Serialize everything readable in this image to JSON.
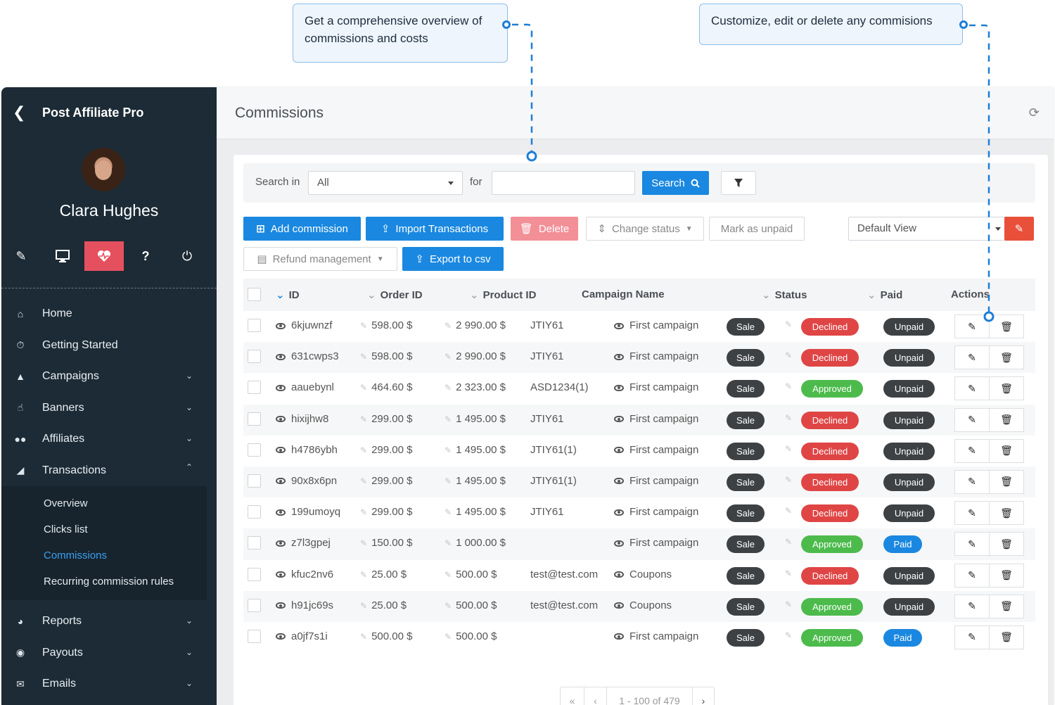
{
  "callouts": {
    "overview": "Get a comprehensive overview of commissions and costs",
    "actions": "Customize, edit or delete any commisions"
  },
  "app": {
    "title": "Post Affiliate Pro",
    "user_name": "Clara Hughes"
  },
  "sidebar": {
    "tools": [
      "pencil-icon",
      "monitor-icon",
      "heartbeat-icon",
      "question-icon",
      "power-icon"
    ],
    "menu": [
      {
        "label": "Home",
        "icon": "home-icon",
        "chevron": false
      },
      {
        "label": "Getting Started",
        "icon": "stopwatch-icon",
        "chevron": false
      },
      {
        "label": "Campaigns",
        "icon": "megaphone-icon",
        "chevron": true
      },
      {
        "label": "Banners",
        "icon": "hand-icon",
        "chevron": true
      },
      {
        "label": "Affiliates",
        "icon": "users-icon",
        "chevron": true
      },
      {
        "label": "Transactions",
        "icon": "basket-icon",
        "chevron": true,
        "expanded": true
      }
    ],
    "submenu": [
      "Overview",
      "Clicks list",
      "Commissions",
      "Recurring commission rules"
    ],
    "submenu_active": "Commissions",
    "menu_after": [
      {
        "label": "Reports",
        "icon": "pie-chart-icon"
      },
      {
        "label": "Payouts",
        "icon": "money-bag-icon"
      },
      {
        "label": "Emails",
        "icon": "envelope-icon"
      }
    ]
  },
  "header": {
    "title": "Commissions"
  },
  "search": {
    "search_in_label": "Search in",
    "search_in_value": "All",
    "for_label": "for",
    "search_button": "Search"
  },
  "toolbar": {
    "add_commission": "Add commission",
    "import_transactions": "Import Transactions",
    "delete": "Delete",
    "change_status": "Change status",
    "mark_as_unpaid": "Mark as unpaid",
    "view_select": "Default View",
    "refund_management": "Refund management",
    "export_csv": "Export to csv"
  },
  "table": {
    "columns": [
      "ID",
      "Order ID",
      "Product ID",
      "Campaign Name",
      "Status",
      "Paid",
      "Actions"
    ],
    "rows": [
      {
        "id": "6kjuwnzf",
        "order": "598.00 $",
        "product": "2 990.00 $",
        "product_id": "JTIY61",
        "campaign": "First campaign",
        "type": "Sale",
        "status": "Declined",
        "paid": "Unpaid"
      },
      {
        "id": "631cwps3",
        "order": "598.00 $",
        "product": "2 990.00 $",
        "product_id": "JTIY61",
        "campaign": "First campaign",
        "type": "Sale",
        "status": "Declined",
        "paid": "Unpaid"
      },
      {
        "id": "aauebynl",
        "order": "464.60 $",
        "product": "2 323.00 $",
        "product_id": "ASD1234(1)",
        "campaign": "First campaign",
        "type": "Sale",
        "status": "Approved",
        "paid": "Unpaid"
      },
      {
        "id": "hixijhw8",
        "order": "299.00 $",
        "product": "1 495.00 $",
        "product_id": "JTIY61",
        "campaign": "First campaign",
        "type": "Sale",
        "status": "Declined",
        "paid": "Unpaid"
      },
      {
        "id": "h4786ybh",
        "order": "299.00 $",
        "product": "1 495.00 $",
        "product_id": "JTIY61(1)",
        "campaign": "First campaign",
        "type": "Sale",
        "status": "Declined",
        "paid": "Unpaid"
      },
      {
        "id": "90x8x6pn",
        "order": "299.00 $",
        "product": "1 495.00 $",
        "product_id": "JTIY61(1)",
        "campaign": "First campaign",
        "type": "Sale",
        "status": "Declined",
        "paid": "Unpaid"
      },
      {
        "id": "199umoyq",
        "order": "299.00 $",
        "product": "1 495.00 $",
        "product_id": "JTIY61",
        "campaign": "First campaign",
        "type": "Sale",
        "status": "Declined",
        "paid": "Unpaid"
      },
      {
        "id": "z7l3gpej",
        "order": "150.00 $",
        "product": "1 000.00 $",
        "product_id": "",
        "campaign": "First campaign",
        "type": "Sale",
        "status": "Approved",
        "paid": "Paid"
      },
      {
        "id": "kfuc2nv6",
        "order": "25.00 $",
        "product": "500.00 $",
        "product_id": "test@test.com",
        "campaign": "Coupons",
        "type": "Sale",
        "status": "Declined",
        "paid": "Unpaid"
      },
      {
        "id": "h91jc69s",
        "order": "25.00 $",
        "product": "500.00 $",
        "product_id": "test@test.com",
        "campaign": "Coupons",
        "type": "Sale",
        "status": "Approved",
        "paid": "Unpaid"
      },
      {
        "id": "a0jf7s1i",
        "order": "500.00 $",
        "product": "500.00 $",
        "product_id": "",
        "campaign": "First campaign",
        "type": "Sale",
        "status": "Approved",
        "paid": "Paid"
      }
    ]
  },
  "pager": {
    "first": "«",
    "prev": "‹",
    "range": "1 - 100 of 479",
    "next": "›"
  },
  "colors": {
    "sidebar": "#1c2b36",
    "accent": "#1a88e0",
    "danger": "#e04545",
    "success": "#4cbb4c",
    "active_tool": "#e5505f"
  }
}
